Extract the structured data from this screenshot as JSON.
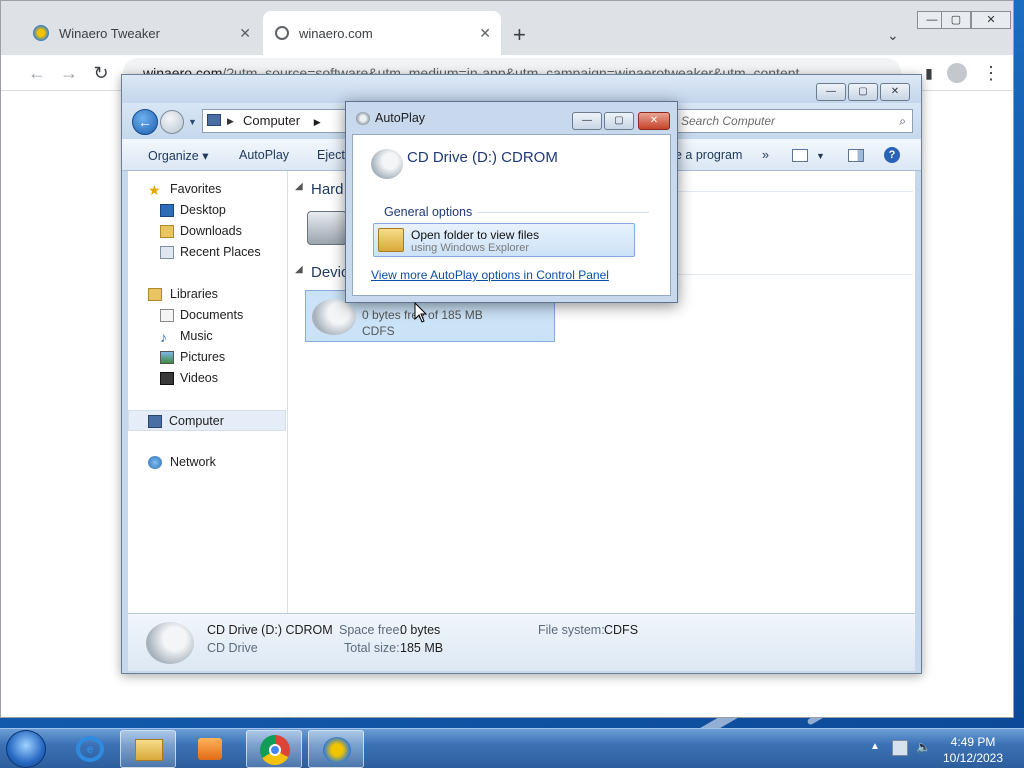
{
  "chrome": {
    "tabs": [
      {
        "label": "Winaero Tweaker",
        "active": false
      },
      {
        "label": "winaero.com",
        "active": true
      }
    ],
    "new_tab": "+",
    "tab_search": "⌄",
    "close_glyph": "✕",
    "window_controls": {
      "minimize": "—",
      "maximize": "▢",
      "close": "✕"
    },
    "url_host": "winaero.com",
    "url_path": "/?utm_source=software&utm_medium=in-app&utm_campaign=winaerotweaker&utm_content"
  },
  "explorer": {
    "address_segment": "Computer",
    "search_placeholder": "Search Computer",
    "commands": {
      "organize": "Organize ▾",
      "autoplay": "AutoPlay",
      "eject": "Eject",
      "program": "e a program",
      "more": "»"
    },
    "nav": {
      "favorites": "Favorites",
      "desktop": "Desktop",
      "downloads": "Downloads",
      "recent_places": "Recent Places",
      "libraries": "Libraries",
      "documents": "Documents",
      "music": "Music",
      "pictures": "Pictures",
      "videos": "Videos",
      "computer": "Computer",
      "network": "Network"
    },
    "groups": {
      "hard_disks": "Hard",
      "devices": "Devic"
    },
    "drive_tile": {
      "space": "0 bytes free of 185 MB",
      "fs": "CDFS"
    },
    "details": {
      "name": "CD Drive (D:) CDROM",
      "type": "CD Drive",
      "space_free_label": "Space free:",
      "space_free": "0 bytes",
      "total_size_label": "Total size:",
      "total_size": "185 MB",
      "file_system_label": "File system:",
      "file_system": "CDFS"
    }
  },
  "autoplay": {
    "title": "AutoPlay",
    "heading": "CD Drive (D:) CDROM",
    "group": "General options",
    "option_title": "Open folder to view files",
    "option_subtitle": "using Windows Explorer",
    "link": "View more AutoPlay options in Control Panel"
  },
  "taskbar": {
    "time": "4:49 PM",
    "date": "10/12/2023"
  },
  "colors": {
    "desktop_blue": "#1663b8",
    "link_blue": "#0a4fa8",
    "selection": "#cbe3f7"
  }
}
